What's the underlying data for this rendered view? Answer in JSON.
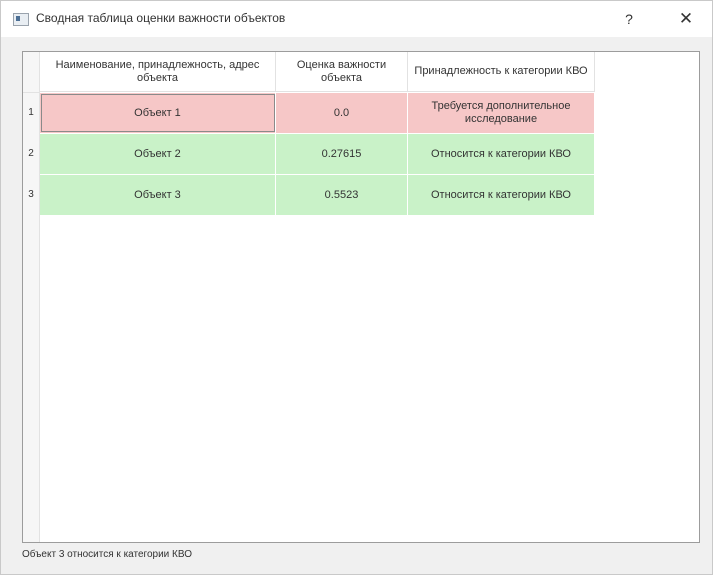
{
  "window": {
    "title": "Сводная таблица оценки важности объектов",
    "help_glyph": "?",
    "close_glyph": "✕"
  },
  "table": {
    "headers": [
      "Наименование, принадлежность, адрес объекта",
      "Оценка важности объекта",
      "Принадлежность к категории КВО"
    ],
    "rows": [
      {
        "num": "1",
        "name": "Объект 1",
        "score": "0.0",
        "category": "Требуется дополнительное исследование",
        "status": "red"
      },
      {
        "num": "2",
        "name": "Объект 2",
        "score": "0.27615",
        "category": "Относится к категории КВО",
        "status": "green"
      },
      {
        "num": "3",
        "name": "Объект 3",
        "score": "0.5523",
        "category": "Относится к категории КВО",
        "status": "green"
      }
    ]
  },
  "status_bar": {
    "text": "Объект 3 относится к категории КВО"
  },
  "colors": {
    "needs_research": "#f6c7c7",
    "kvo": "#c9f2c8"
  }
}
